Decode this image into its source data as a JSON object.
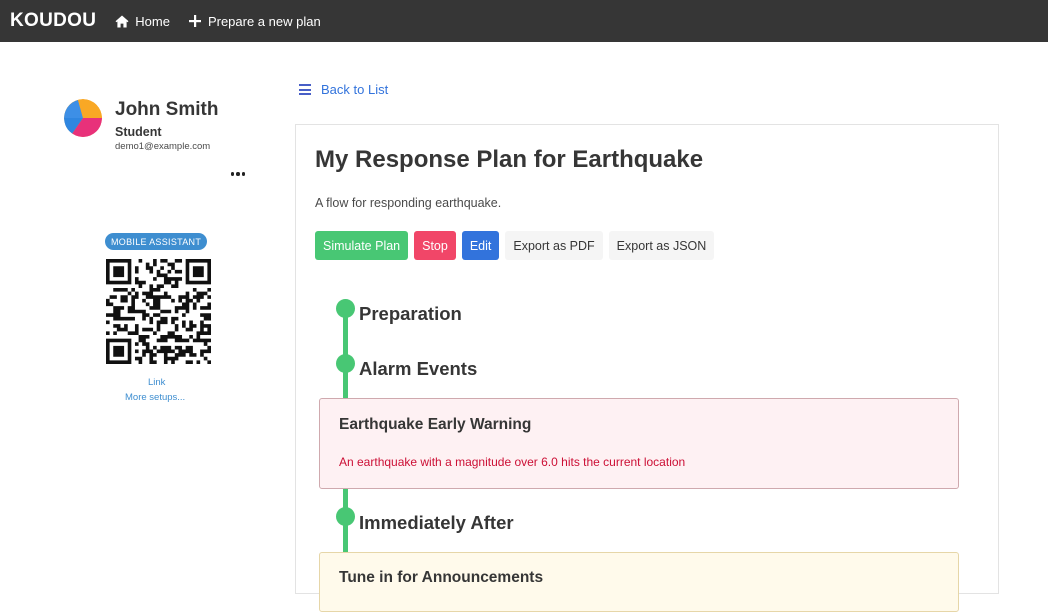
{
  "navbar": {
    "brand": "KOUDOU",
    "items": [
      {
        "label": "Home",
        "icon": "home-icon"
      },
      {
        "label": "Prepare a new plan",
        "icon": "plus-icon"
      }
    ]
  },
  "sidebar": {
    "user": {
      "name": "John Smith",
      "role": "Student",
      "email": "demo1@example.com"
    },
    "assistant_tag": "MOBILE ASSISTANT",
    "links": [
      "Link",
      "More setups..."
    ]
  },
  "main": {
    "back_link": "Back to List",
    "plan": {
      "title": "My Response Plan for Earthquake",
      "description": "A flow for responding earthquake."
    },
    "buttons": {
      "simulate": "Simulate Plan",
      "stop": "Stop",
      "edit": "Edit",
      "export_pdf": "Export as PDF",
      "export_json": "Export as JSON"
    },
    "timeline": {
      "phases": [
        "Preparation",
        "Alarm Events",
        "Immediately After"
      ],
      "events": [
        {
          "title": "Earthquake Early Warning",
          "description": "An earthquake with a magnitude over 6.0 hits the current location"
        },
        {
          "title": "Tune in for Announcements",
          "description": ""
        }
      ]
    }
  },
  "colors": {
    "navbar": "#363636",
    "success": "#48c774",
    "danger": "#f14668",
    "link": "#3273dc",
    "info": "#3e8ed0"
  }
}
